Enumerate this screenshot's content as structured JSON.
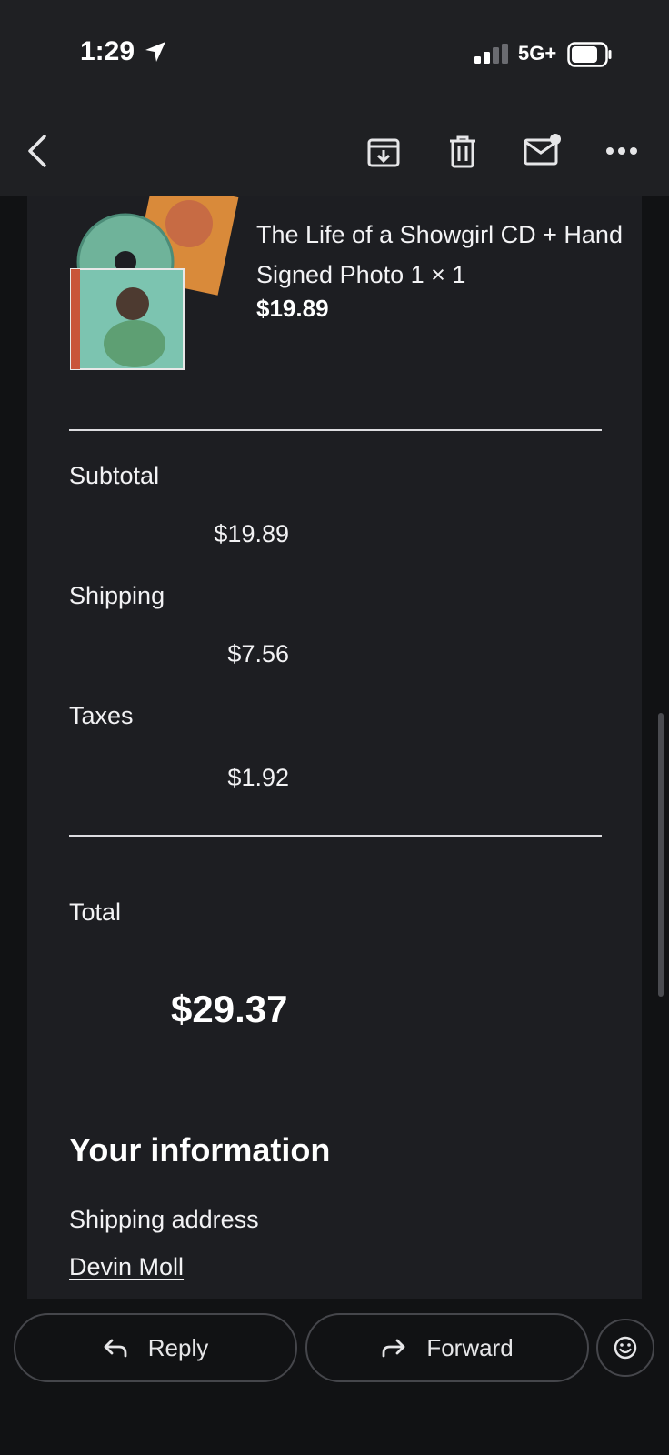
{
  "status_bar": {
    "time": "1:29",
    "network": "5G+"
  },
  "toolbar": {
    "icons": [
      "back-icon",
      "archive-icon",
      "trash-icon",
      "mark-unread-icon",
      "more-icon"
    ]
  },
  "order": {
    "product_name": "The Life of a Showgirl CD + Hand Signed Photo 1 × 1",
    "product_price": "$19.89",
    "subtotal_label": "Subtotal",
    "subtotal_value": "$19.89",
    "shipping_label": "Shipping",
    "shipping_value": "$7.56",
    "taxes_label": "Taxes",
    "taxes_value": "$1.92",
    "total_label": "Total",
    "total_value": "$29.37"
  },
  "info": {
    "title": "Your information",
    "shipping_address_label": "Shipping address",
    "name": "Devin Moll"
  },
  "actions": {
    "reply_label": "Reply",
    "forward_label": "Forward"
  },
  "colors": {
    "background": "#111214",
    "card": "#1d1e22",
    "bar": "#1f2023"
  }
}
